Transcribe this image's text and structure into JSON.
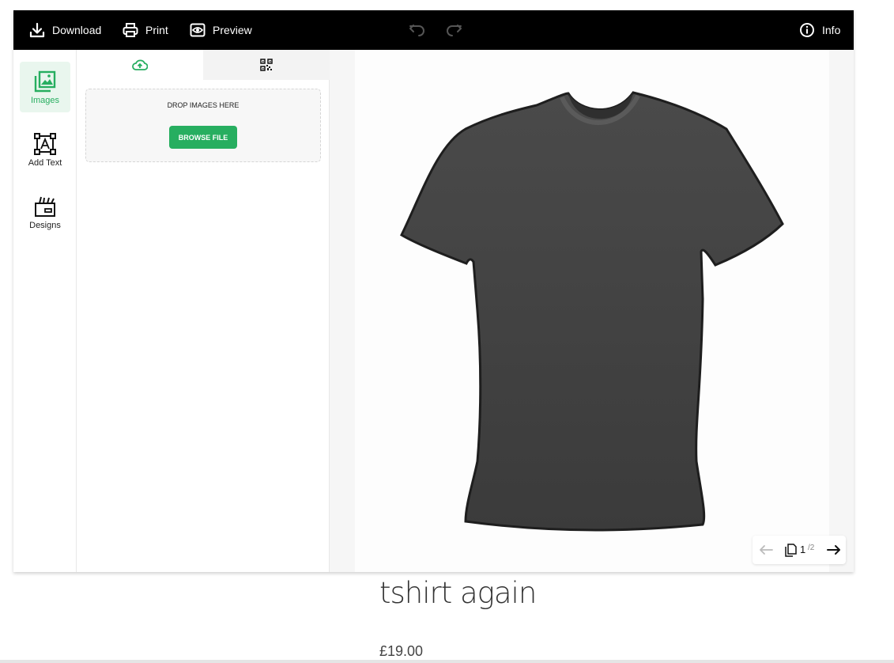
{
  "toolbar": {
    "download_label": "Download",
    "print_label": "Print",
    "preview_label": "Preview",
    "info_label": "Info"
  },
  "sidebar": {
    "items": [
      {
        "label": "Images",
        "icon": "image-gallery-icon",
        "active": true
      },
      {
        "label": "Add Text",
        "icon": "text-box-icon",
        "active": false
      },
      {
        "label": "Designs",
        "icon": "design-folder-icon",
        "active": false
      }
    ]
  },
  "panel": {
    "tabs": [
      {
        "icon": "cloud-upload-icon",
        "active": true
      },
      {
        "icon": "qr-code-icon",
        "active": false
      }
    ],
    "drop_label": "DROP IMAGES HERE",
    "browse_label": "BROWSE FILE"
  },
  "pager": {
    "current": "1",
    "total": "/2"
  },
  "product": {
    "title": "tshirt again",
    "price": "£19.00"
  },
  "colors": {
    "accent": "#27ae60",
    "toolbar_bg": "#000000",
    "shirt": "#474747"
  }
}
